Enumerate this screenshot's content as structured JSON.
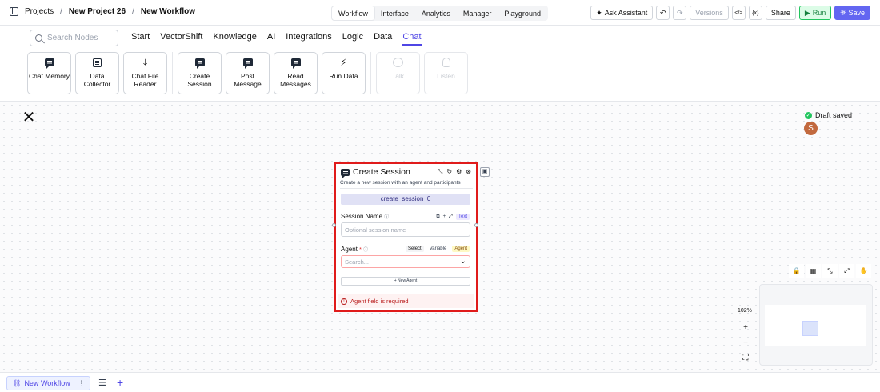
{
  "topbar": {
    "breadcrumbs": [
      "Projects",
      "New Project 26",
      "New Workflow"
    ],
    "modes": [
      "Workflow",
      "Interface",
      "Analytics",
      "Manager",
      "Playground"
    ],
    "active_mode": "Workflow",
    "ask_assistant": "Ask Assistant",
    "versions": "Versions",
    "code_icon_label": "</>",
    "vars_icon_label": "{x}",
    "share": "Share",
    "run": "Run",
    "save": "Save"
  },
  "palette": {
    "search_placeholder": "Search Nodes",
    "categories": [
      "Start",
      "VectorShift",
      "Knowledge",
      "AI",
      "Integrations",
      "Logic",
      "Data",
      "Chat"
    ],
    "active_category": "Chat",
    "tiles": [
      {
        "label": "Chat Memory",
        "icon": "message-icon",
        "enabled": true
      },
      {
        "label": "Data Collector",
        "icon": "list-icon",
        "enabled": true
      },
      {
        "label": "Chat File Reader",
        "icon": "download-icon",
        "enabled": true
      },
      {
        "label": "Create Session",
        "icon": "message-icon",
        "enabled": true
      },
      {
        "label": "Post Message",
        "icon": "message-icon",
        "enabled": true
      },
      {
        "label": "Read Messages",
        "icon": "message-icon",
        "enabled": true
      },
      {
        "label": "Run Data",
        "icon": "sparkle-icon",
        "enabled": true
      },
      {
        "label": "Talk",
        "icon": "bubble-icon",
        "enabled": false
      },
      {
        "label": "Listen",
        "icon": "mic-icon",
        "enabled": false
      }
    ]
  },
  "canvas": {
    "draft_status": "Draft saved",
    "avatar_initial": "S",
    "zoom_level": "102%"
  },
  "node": {
    "title": "Create Session",
    "description": "Create a new session with an agent and participants",
    "id_name": "create_session_0",
    "session_name": {
      "label": "Session Name",
      "info": "ⓘ",
      "type_pill": "Text",
      "placeholder": "Optional session name"
    },
    "agent": {
      "label": "Agent",
      "required_mark": "*",
      "info": "ⓘ",
      "mode_select": "Select",
      "mode_variable": "Variable",
      "type_pill": "Agent",
      "placeholder": "Search...",
      "new_agent": "+ New Agent"
    },
    "error": "Agent field is required"
  },
  "bottom": {
    "tab_label": "New Workflow"
  }
}
